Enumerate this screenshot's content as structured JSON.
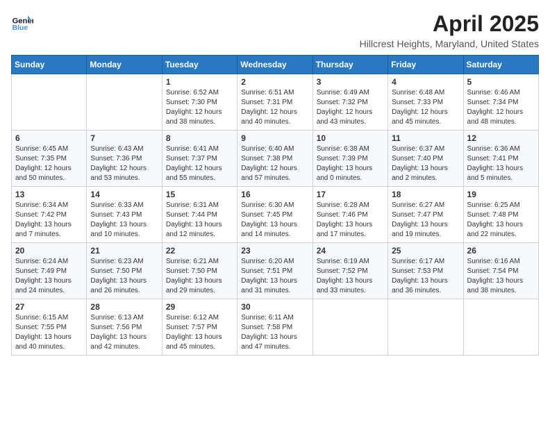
{
  "logo": {
    "line1": "General",
    "line2": "Blue"
  },
  "title": "April 2025",
  "location": "Hillcrest Heights, Maryland, United States",
  "weekdays": [
    "Sunday",
    "Monday",
    "Tuesday",
    "Wednesday",
    "Thursday",
    "Friday",
    "Saturday"
  ],
  "weeks": [
    [
      {
        "day": "",
        "text": ""
      },
      {
        "day": "",
        "text": ""
      },
      {
        "day": "1",
        "text": "Sunrise: 6:52 AM\nSunset: 7:30 PM\nDaylight: 12 hours and 38 minutes."
      },
      {
        "day": "2",
        "text": "Sunrise: 6:51 AM\nSunset: 7:31 PM\nDaylight: 12 hours and 40 minutes."
      },
      {
        "day": "3",
        "text": "Sunrise: 6:49 AM\nSunset: 7:32 PM\nDaylight: 12 hours and 43 minutes."
      },
      {
        "day": "4",
        "text": "Sunrise: 6:48 AM\nSunset: 7:33 PM\nDaylight: 12 hours and 45 minutes."
      },
      {
        "day": "5",
        "text": "Sunrise: 6:46 AM\nSunset: 7:34 PM\nDaylight: 12 hours and 48 minutes."
      }
    ],
    [
      {
        "day": "6",
        "text": "Sunrise: 6:45 AM\nSunset: 7:35 PM\nDaylight: 12 hours and 50 minutes."
      },
      {
        "day": "7",
        "text": "Sunrise: 6:43 AM\nSunset: 7:36 PM\nDaylight: 12 hours and 53 minutes."
      },
      {
        "day": "8",
        "text": "Sunrise: 6:41 AM\nSunset: 7:37 PM\nDaylight: 12 hours and 55 minutes."
      },
      {
        "day": "9",
        "text": "Sunrise: 6:40 AM\nSunset: 7:38 PM\nDaylight: 12 hours and 57 minutes."
      },
      {
        "day": "10",
        "text": "Sunrise: 6:38 AM\nSunset: 7:39 PM\nDaylight: 13 hours and 0 minutes."
      },
      {
        "day": "11",
        "text": "Sunrise: 6:37 AM\nSunset: 7:40 PM\nDaylight: 13 hours and 2 minutes."
      },
      {
        "day": "12",
        "text": "Sunrise: 6:36 AM\nSunset: 7:41 PM\nDaylight: 13 hours and 5 minutes."
      }
    ],
    [
      {
        "day": "13",
        "text": "Sunrise: 6:34 AM\nSunset: 7:42 PM\nDaylight: 13 hours and 7 minutes."
      },
      {
        "day": "14",
        "text": "Sunrise: 6:33 AM\nSunset: 7:43 PM\nDaylight: 13 hours and 10 minutes."
      },
      {
        "day": "15",
        "text": "Sunrise: 6:31 AM\nSunset: 7:44 PM\nDaylight: 13 hours and 12 minutes."
      },
      {
        "day": "16",
        "text": "Sunrise: 6:30 AM\nSunset: 7:45 PM\nDaylight: 13 hours and 14 minutes."
      },
      {
        "day": "17",
        "text": "Sunrise: 6:28 AM\nSunset: 7:46 PM\nDaylight: 13 hours and 17 minutes."
      },
      {
        "day": "18",
        "text": "Sunrise: 6:27 AM\nSunset: 7:47 PM\nDaylight: 13 hours and 19 minutes."
      },
      {
        "day": "19",
        "text": "Sunrise: 6:25 AM\nSunset: 7:48 PM\nDaylight: 13 hours and 22 minutes."
      }
    ],
    [
      {
        "day": "20",
        "text": "Sunrise: 6:24 AM\nSunset: 7:49 PM\nDaylight: 13 hours and 24 minutes."
      },
      {
        "day": "21",
        "text": "Sunrise: 6:23 AM\nSunset: 7:50 PM\nDaylight: 13 hours and 26 minutes."
      },
      {
        "day": "22",
        "text": "Sunrise: 6:21 AM\nSunset: 7:50 PM\nDaylight: 13 hours and 29 minutes."
      },
      {
        "day": "23",
        "text": "Sunrise: 6:20 AM\nSunset: 7:51 PM\nDaylight: 13 hours and 31 minutes."
      },
      {
        "day": "24",
        "text": "Sunrise: 6:19 AM\nSunset: 7:52 PM\nDaylight: 13 hours and 33 minutes."
      },
      {
        "day": "25",
        "text": "Sunrise: 6:17 AM\nSunset: 7:53 PM\nDaylight: 13 hours and 36 minutes."
      },
      {
        "day": "26",
        "text": "Sunrise: 6:16 AM\nSunset: 7:54 PM\nDaylight: 13 hours and 38 minutes."
      }
    ],
    [
      {
        "day": "27",
        "text": "Sunrise: 6:15 AM\nSunset: 7:55 PM\nDaylight: 13 hours and 40 minutes."
      },
      {
        "day": "28",
        "text": "Sunrise: 6:13 AM\nSunset: 7:56 PM\nDaylight: 13 hours and 42 minutes."
      },
      {
        "day": "29",
        "text": "Sunrise: 6:12 AM\nSunset: 7:57 PM\nDaylight: 13 hours and 45 minutes."
      },
      {
        "day": "30",
        "text": "Sunrise: 6:11 AM\nSunset: 7:58 PM\nDaylight: 13 hours and 47 minutes."
      },
      {
        "day": "",
        "text": ""
      },
      {
        "day": "",
        "text": ""
      },
      {
        "day": "",
        "text": ""
      }
    ]
  ]
}
